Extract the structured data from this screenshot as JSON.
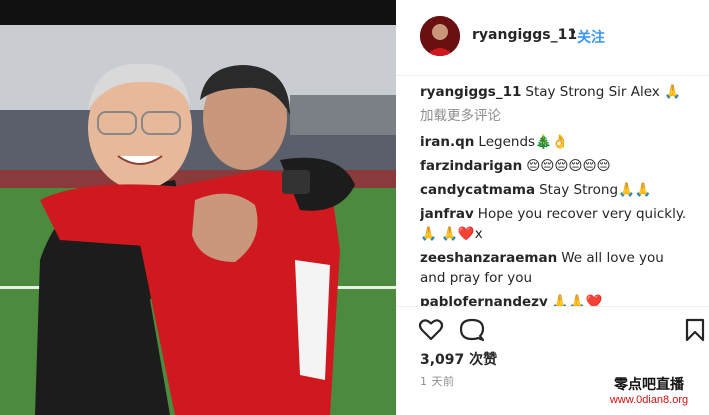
{
  "post": {
    "username": "ryangiggs_11",
    "separator": "•",
    "follow_label": "关注"
  },
  "comments": {
    "caption": {
      "user": "ryangiggs_11",
      "text": "Stay Strong Sir Alex 🙏"
    },
    "load_more_label": "加载更多评论",
    "items": [
      {
        "user": "iran.qn",
        "text": "Legends🎄👌"
      },
      {
        "user": "farzindarigan",
        "text": "😔😔😔😔😔😔"
      },
      {
        "user": "candycatmama",
        "text": "Stay Strong🙏🙏"
      },
      {
        "user": "janfrav",
        "text": "Hope you recover very quickly. 🙏 🙏❤️x"
      },
      {
        "user": "zeeshanzaraeman",
        "text": "We all love you and pray for you"
      },
      {
        "user": "pablofernandezy",
        "text": "🙏🙏❤️"
      }
    ]
  },
  "actions": {
    "like_icon": "heart-outline-icon",
    "comment_icon": "comment-bubble-icon",
    "save_icon": "bookmark-icon"
  },
  "likes_text": "3,097 次赞",
  "time_text": "1 天前",
  "watermark": {
    "title": "零点吧直播",
    "url": "www.0dian8.org"
  },
  "colors": {
    "link_blue": "#3897f0",
    "jersey_red": "#d0191f",
    "grass_green": "#3f7a35"
  }
}
